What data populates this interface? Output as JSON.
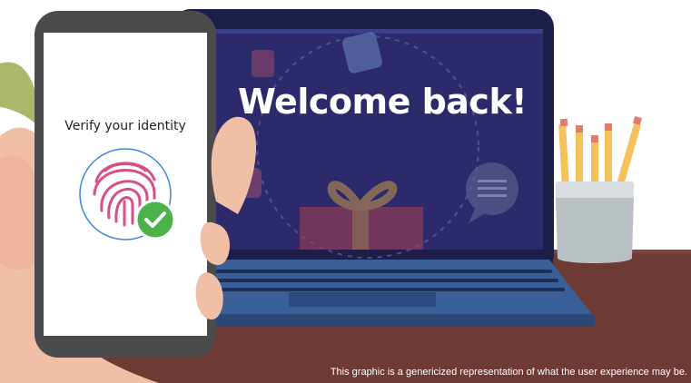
{
  "laptop_screen": {
    "heading": "Welcome back!"
  },
  "phone_screen": {
    "prompt": "Verify your identity"
  },
  "footer": {
    "disclaimer": "This graphic is a genericized representation of what the user experience may be."
  },
  "icons": [
    "fingerprint-icon",
    "checkmark-icon",
    "gift-icon",
    "chat-bubble-icon",
    "pencil-cup"
  ],
  "colors": {
    "laptop_screen": "#2c2a6b",
    "desk": "#6e3a34",
    "fingerprint": "#d64f86",
    "check_badge": "#4cb24a",
    "phone_body": "#4b4b4b"
  }
}
